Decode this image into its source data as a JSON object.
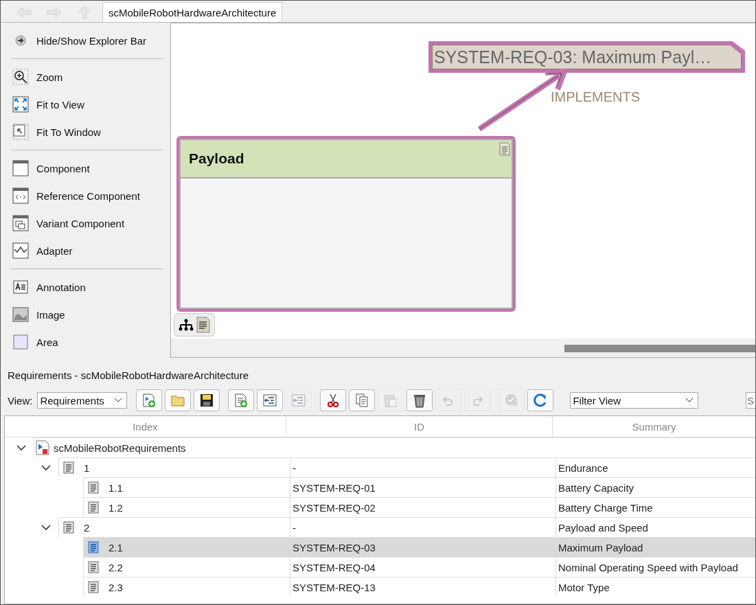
{
  "tab": {
    "label": "scMobileRobotHardwareArchitecture",
    "selected": true
  },
  "palette": [
    [
      "Hide/Show Explorer Bar"
    ],
    [
      "Zoom",
      "Fit to View",
      "Fit To Window"
    ],
    [
      "Component",
      "Reference Component",
      "Variant Component",
      "Adapter"
    ],
    [
      "Annotation",
      "Image",
      "Area"
    ]
  ],
  "diagram": {
    "component": {
      "name": "Payload",
      "highlighted": true
    },
    "requirement": {
      "label": "SYSTEM-REQ-03: Maximum Payl…",
      "highlighted": true
    },
    "link": {
      "label": "IMPLEMENTS",
      "highlighted": true
    }
  },
  "panel": {
    "title": "Requirements - scMobileRobotHardwareArchitecture",
    "view_label": "View:",
    "view_value": "Requirements",
    "filter_value": "Filter View",
    "search_placeholder": "S"
  },
  "toolbar": [
    [
      {
        "disabled": false
      },
      {
        "disabled": false
      },
      {
        "disabled": false
      }
    ],
    [
      {
        "disabled": false
      },
      {
        "disabled": false
      },
      {
        "disabled": true
      }
    ],
    [
      {
        "disabled": false
      },
      {
        "disabled": false
      },
      {
        "disabled": true
      },
      {
        "disabled": false
      },
      {
        "disabled": true
      },
      {
        "disabled": true
      }
    ],
    [
      {
        "disabled": true
      },
      {
        "disabled": false
      }
    ]
  ],
  "table": {
    "columns": [
      "Index",
      "ID",
      "Summary"
    ],
    "rows": [
      {
        "index": "scMobileRobotRequirements",
        "kind": "set",
        "expanded": true,
        "selected": false,
        "children": [
          {
            "index": "1",
            "id": "-",
            "summary": "Endurance",
            "kind": "requirement",
            "expanded": true,
            "selected": false,
            "children": [
              {
                "index": "1.1",
                "id": "SYSTEM-REQ-01",
                "summary": "Battery Capacity",
                "kind": "requirement",
                "selected": false
              },
              {
                "index": "1.2",
                "id": "SYSTEM-REQ-02",
                "summary": "Battery Charge Time",
                "kind": "requirement",
                "selected": false
              }
            ]
          },
          {
            "index": "2",
            "id": "-",
            "summary": "Payload and Speed",
            "kind": "requirement",
            "expanded": true,
            "selected": false,
            "children": [
              {
                "index": "2.1",
                "id": "SYSTEM-REQ-03",
                "summary": "Maximum Payload",
                "kind": "requirement",
                "selected": true
              },
              {
                "index": "2.2",
                "id": "SYSTEM-REQ-04",
                "summary": "Nominal Operating Speed with Payload",
                "kind": "requirement",
                "selected": false
              },
              {
                "index": "2.3",
                "id": "SYSTEM-REQ-13",
                "summary": "Motor Type",
                "kind": "requirement",
                "selected": false
              }
            ]
          }
        ]
      }
    ]
  }
}
